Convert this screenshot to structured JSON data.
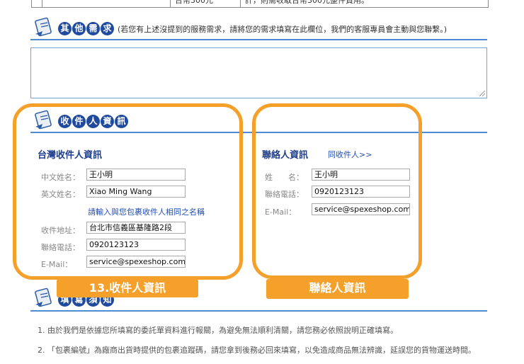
{
  "top_row": {
    "cell_a": "台幣300元",
    "cell_b": "訐，則需收取台幣300元整件費用。"
  },
  "other_needs": {
    "title_chars": [
      "其",
      "他",
      "需",
      "求"
    ],
    "note": "(若您有上述沒提到的服務需求，請將您的需求填寫在此欄位，我們的客服專員會主動與您聯繫。)",
    "textarea_value": ""
  },
  "recipient_section": {
    "title_chars": [
      "收",
      "件",
      "人",
      "資",
      "訊"
    ]
  },
  "taiwan_recipient": {
    "heading": "台灣收件人資訊",
    "name_zh_label": "中文姓名：",
    "name_zh_value": "王小明",
    "name_en_label": "英文姓名：",
    "name_en_value": "Xiao Ming Wang",
    "hint": "請輸入與您包裹收件人相同之名稱",
    "address_label": "收件地址：",
    "address_value": "台北市信義區基隆路2段",
    "phone_label": "聯絡電話：",
    "phone_value": "0920123123",
    "email_label": "E-Mail：",
    "email_value": "service@spexeshop.com"
  },
  "contact": {
    "heading": "聯絡人資訊",
    "same_link": "同收件人>>",
    "name_label": "姓　　名：",
    "name_value": "王小明",
    "phone_label": "聯絡電話：",
    "phone_value": "0920123123",
    "email_label": "E-Mail：",
    "email_value": "service@spexeshop.com"
  },
  "annotations": {
    "left_tag": "13.收件人資訊",
    "right_tag": "聯絡人資訊",
    "color": "#f5a02a"
  },
  "notice_section": {
    "title_chars": [
      "填",
      "寫",
      "須",
      "知"
    ],
    "item1": "1. 由於我們是依據您所填寫的委託單資料進行報關，為避免無法順利清關，請您務必依照說明正確填寫。",
    "item2": "2. 「包裹編號」為廠商出貨時提供的包裹追蹤碼，請您拿到後務必回來填寫，以免造成商品無法辨識，延誤您的貨物運送時間。"
  }
}
